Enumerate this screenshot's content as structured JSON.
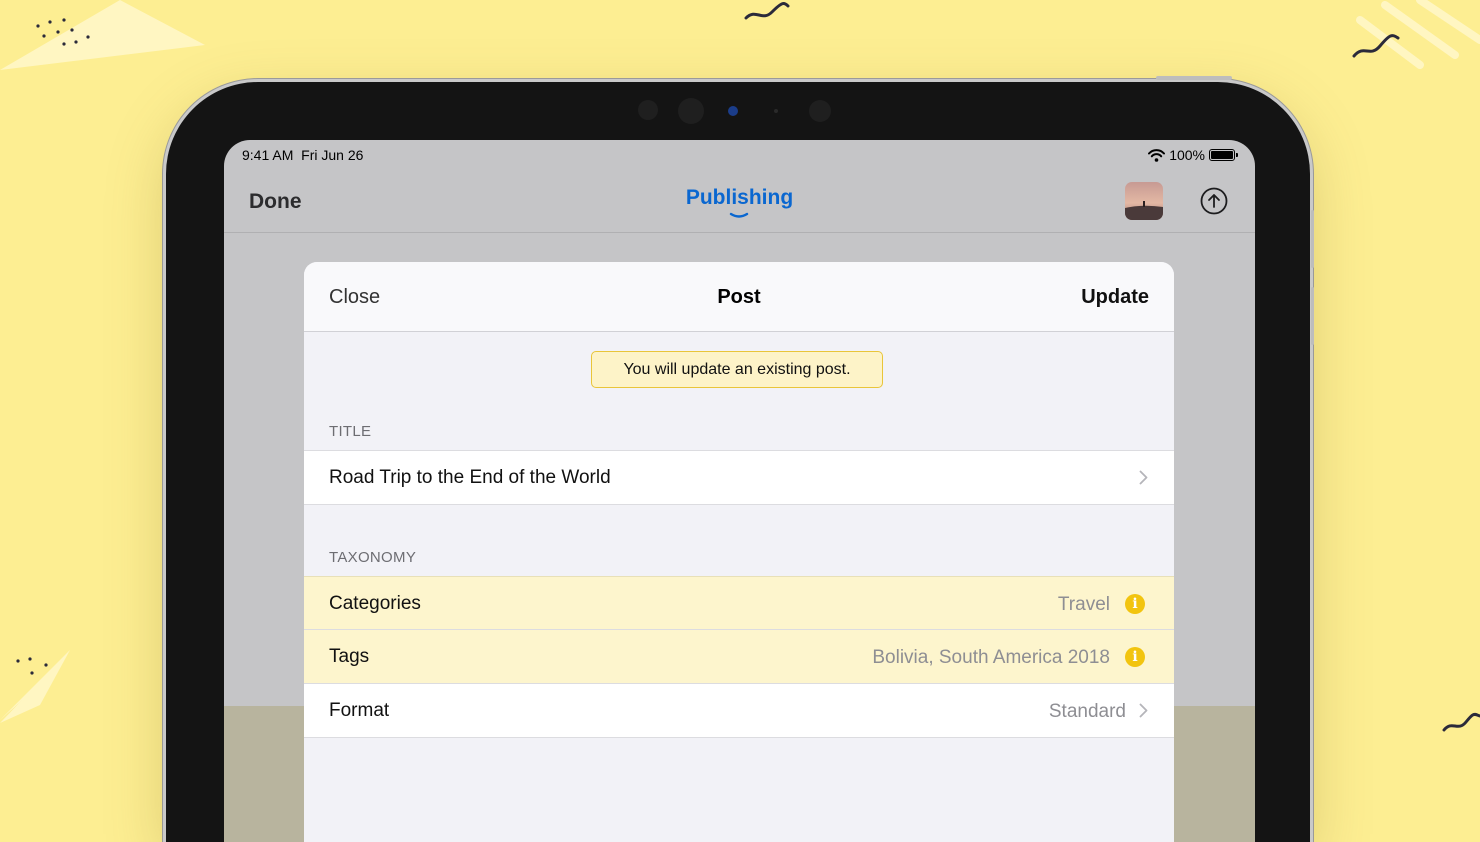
{
  "status_bar": {
    "time": "9:41 AM",
    "date": "Fri Jun 26",
    "battery": "100%"
  },
  "app_nav": {
    "done_label": "Done",
    "title": "Publishing"
  },
  "sheet": {
    "close_label": "Close",
    "title": "Post",
    "update_label": "Update",
    "notice": "You will update an existing post.",
    "sections": {
      "title_header": "TITLE",
      "taxonomy_header": "TAXONOMY"
    },
    "title_row": {
      "label": "Road Trip to the End of the World"
    },
    "taxonomy_rows": [
      {
        "label": "Categories",
        "value": "Travel",
        "icon": "info-icon"
      },
      {
        "label": "Tags",
        "value": "Bolivia, South America 2018",
        "icon": "info-icon"
      },
      {
        "label": "Format",
        "value": "Standard",
        "icon": "chevron-right-icon"
      }
    ]
  },
  "colors": {
    "background": "#FDEE92",
    "accent_blue": "#0A67D0",
    "warning_yellow": "#F2C40F",
    "highlight_row": "#FDF5CD"
  }
}
